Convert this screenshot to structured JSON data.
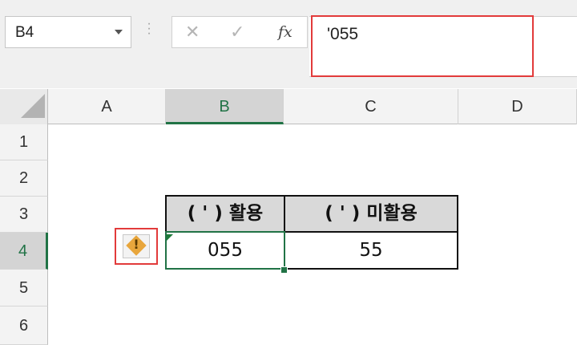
{
  "name_box": {
    "value": "B4"
  },
  "formula_bar": {
    "content": "'055",
    "cancel_glyph": "✕",
    "enter_glyph": "✓",
    "fx_label": "fx"
  },
  "columns": [
    "A",
    "B",
    "C",
    "D"
  ],
  "rows": [
    "1",
    "2",
    "3",
    "4",
    "5",
    "6"
  ],
  "selected_cell": {
    "column": "B",
    "row": "4"
  },
  "table": {
    "headers": [
      "( ' ) 활용",
      "( ' ) 미활용"
    ],
    "values": [
      "055",
      "55"
    ]
  },
  "icons": {
    "name_box_dropdown": "chevron-down-icon",
    "error_indicator": "warning-diamond-icon",
    "error_mark": "!"
  },
  "colors": {
    "accent_green": "#217346",
    "highlight_red": "#e23b3b",
    "warning_orange": "#e8a63c"
  }
}
